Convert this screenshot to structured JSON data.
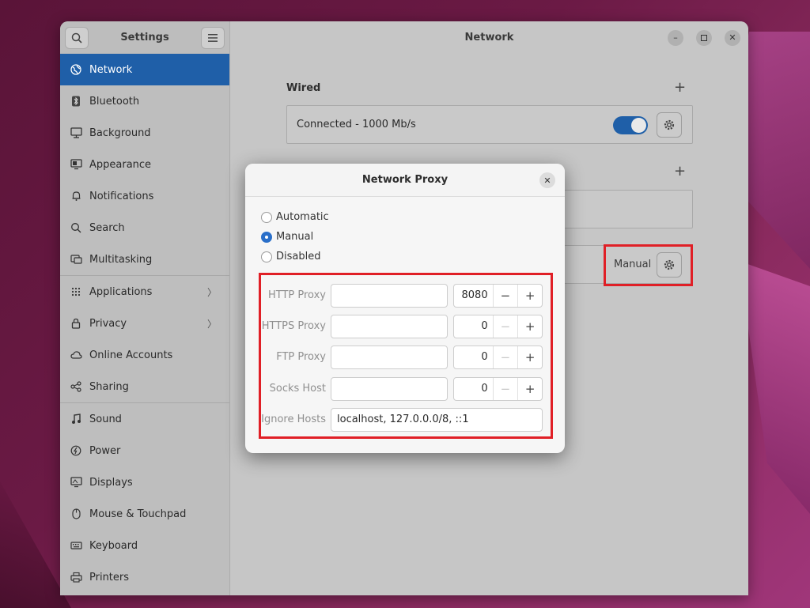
{
  "window": {
    "sidebar_title": "Settings",
    "page_title": "Network"
  },
  "sidebar": {
    "items": [
      {
        "label": "Network",
        "icon": "globe-icon",
        "active": true
      },
      {
        "label": "Bluetooth",
        "icon": "bluetooth-icon"
      },
      {
        "label": "Background",
        "icon": "monitor-icon"
      },
      {
        "label": "Appearance",
        "icon": "appearance-icon"
      },
      {
        "label": "Notifications",
        "icon": "bell-icon"
      },
      {
        "label": "Search",
        "icon": "search-icon"
      },
      {
        "label": "Multitasking",
        "icon": "multitasking-icon"
      },
      {
        "label": "Applications",
        "icon": "grid-icon",
        "chevron": true
      },
      {
        "label": "Privacy",
        "icon": "lock-icon",
        "chevron": true
      },
      {
        "label": "Online Accounts",
        "icon": "cloud-icon"
      },
      {
        "label": "Sharing",
        "icon": "share-icon"
      },
      {
        "label": "Sound",
        "icon": "music-note-icon"
      },
      {
        "label": "Power",
        "icon": "power-icon"
      },
      {
        "label": "Displays",
        "icon": "display-icon"
      },
      {
        "label": "Mouse & Touchpad",
        "icon": "mouse-icon"
      },
      {
        "label": "Keyboard",
        "icon": "keyboard-icon"
      },
      {
        "label": "Printers",
        "icon": "printer-icon"
      }
    ]
  },
  "main": {
    "wired": {
      "heading": "Wired",
      "status": "Connected - 1000 Mb/s",
      "enabled": true
    },
    "proxy_status": "Manual"
  },
  "dialog": {
    "title": "Network Proxy",
    "modes": [
      {
        "label": "Automatic",
        "checked": false
      },
      {
        "label": "Manual",
        "checked": true
      },
      {
        "label": "Disabled",
        "checked": false
      }
    ],
    "proxies": [
      {
        "label": "HTTP Proxy",
        "host": "",
        "port": "8080"
      },
      {
        "label": "HTTPS Proxy",
        "host": "",
        "port": "0"
      },
      {
        "label": "FTP Proxy",
        "host": "",
        "port": "0"
      },
      {
        "label": "Socks Host",
        "host": "",
        "port": "0"
      }
    ],
    "ignore_hosts": {
      "label": "Ignore Hosts",
      "value": "localhost, 127.0.0.0/8, ::1"
    }
  },
  "colors": {
    "accent": "#1f5fa8",
    "highlight": "#e01f26"
  }
}
